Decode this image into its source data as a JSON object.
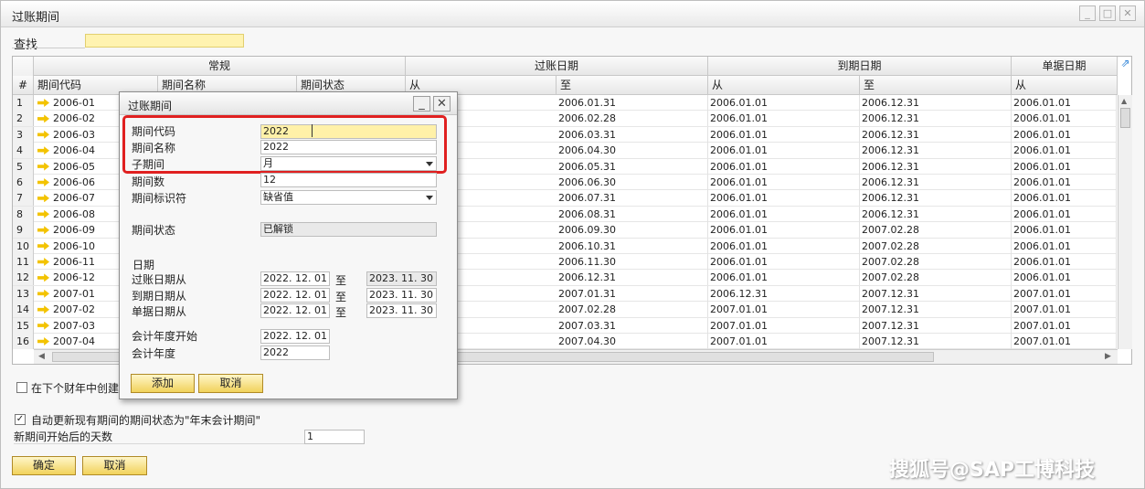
{
  "window": {
    "title": "过账期间",
    "buttons": [
      "_",
      "□",
      "✕"
    ]
  },
  "search": {
    "label": "查找",
    "value": ""
  },
  "grid": {
    "groups": [
      "常规",
      "过账日期",
      "到期日期",
      "单据日期"
    ],
    "headers": [
      "#",
      "期间代码",
      "期间名称",
      "期间状态",
      "从",
      "至",
      "从",
      "至",
      "从"
    ],
    "rows": [
      [
        "1",
        "2006-01",
        "2006.01.31",
        "2006.01.01",
        "2006.12.31",
        "2006.01.01"
      ],
      [
        "2",
        "2006-02",
        "2006.02.28",
        "2006.01.01",
        "2006.12.31",
        "2006.01.01"
      ],
      [
        "3",
        "2006-03",
        "2006.03.31",
        "2006.01.01",
        "2006.12.31",
        "2006.01.01"
      ],
      [
        "4",
        "2006-04",
        "2006.04.30",
        "2006.01.01",
        "2006.12.31",
        "2006.01.01"
      ],
      [
        "5",
        "2006-05",
        "2006.05.31",
        "2006.01.01",
        "2006.12.31",
        "2006.01.01"
      ],
      [
        "6",
        "2006-06",
        "2006.06.30",
        "2006.01.01",
        "2006.12.31",
        "2006.01.01"
      ],
      [
        "7",
        "2006-07",
        "2006.07.31",
        "2006.01.01",
        "2006.12.31",
        "2006.01.01"
      ],
      [
        "8",
        "2006-08",
        "2006.08.31",
        "2006.01.01",
        "2006.12.31",
        "2006.01.01"
      ],
      [
        "9",
        "2006-09",
        "2006.09.30",
        "2006.01.01",
        "2007.02.28",
        "2006.01.01"
      ],
      [
        "10",
        "2006-10",
        "2006.10.31",
        "2006.01.01",
        "2007.02.28",
        "2006.01.01"
      ],
      [
        "11",
        "2006-11",
        "2006.11.30",
        "2006.01.01",
        "2007.02.28",
        "2006.01.01"
      ],
      [
        "12",
        "2006-12",
        "2006.12.31",
        "2006.01.01",
        "2007.02.28",
        "2006.01.01"
      ],
      [
        "13",
        "2007-01",
        "2007.01.31",
        "2006.12.31",
        "2007.12.31",
        "2007.01.01"
      ],
      [
        "14",
        "2007-02",
        "2007.02.28",
        "2007.01.01",
        "2007.12.31",
        "2007.01.01"
      ],
      [
        "15",
        "2007-03",
        "2007.03.31",
        "2007.01.01",
        "2007.12.31",
        "2007.01.01"
      ],
      [
        "16",
        "2007-04",
        "2007.04.30",
        "2007.01.01",
        "2007.12.31",
        "2007.01.01"
      ]
    ]
  },
  "dialog": {
    "title": "过账期间",
    "labels": {
      "period_code": "期间代码",
      "period_name": "期间名称",
      "sub_period": "子期间",
      "period_count": "期间数",
      "period_indicator": "期间标识符",
      "period_status": "期间状态",
      "dates_heading": "日期",
      "posting_from": "过账日期从",
      "due_from": "到期日期从",
      "doc_from": "单据日期从",
      "to": "至",
      "fy_start": "会计年度开始",
      "fy": "会计年度"
    },
    "values": {
      "period_code": "2022",
      "period_name": "2022",
      "sub_period": "月",
      "period_count": "12",
      "period_indicator": "缺省值",
      "period_status": "已解锁",
      "posting_from": "2022. 12. 01",
      "posting_to": "2023. 11. 30",
      "due_from": "2022. 12. 01",
      "due_to": "2023. 11. 30",
      "doc_from": "2022. 12. 01",
      "doc_to": "2023. 11. 30",
      "fy_start": "2022. 12. 01",
      "fy": "2022"
    },
    "buttons": {
      "add": "添加",
      "cancel": "取消"
    }
  },
  "options": {
    "create_next_year": "在下个财年中创建",
    "auto_update": "自动更新现有期间的期间状态为\"年末会计期间\"",
    "days_label": "新期间开始后的天数",
    "days_value": "1"
  },
  "footer": {
    "ok": "确定",
    "cancel": "取消"
  },
  "watermark": "搜狐号@SAP工博科技"
}
